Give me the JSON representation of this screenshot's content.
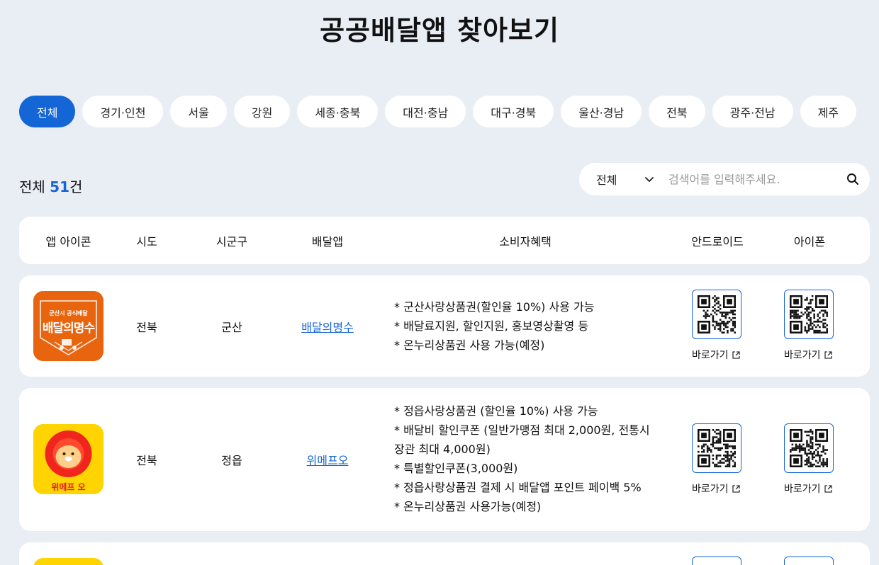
{
  "title": "공공배달앱 찾아보기",
  "regions": [
    "전체",
    "경기·인천",
    "서울",
    "강원",
    "세종·충북",
    "대전·충남",
    "대구·경북",
    "울산·경남",
    "전북",
    "광주·전남",
    "제주"
  ],
  "active_region": "전체",
  "result": {
    "prefix": "전체 ",
    "count": "51",
    "suffix": "건"
  },
  "search": {
    "select_value": "전체",
    "placeholder": "검색어를 입력해주세요."
  },
  "columns": [
    "앱 아이콘",
    "시도",
    "시군구",
    "배달앱",
    "소비자혜택",
    "안드로이드",
    "아이폰"
  ],
  "rows": [
    {
      "sido": "전북",
      "sigungu": "군산",
      "app": "배달의명수",
      "icon_top_text": "군산시 공식배달",
      "icon_main_text": "배달의명수",
      "benefits": [
        "* 군산사랑상품권(할인율 10%) 사용 가능",
        "* 배달료지원, 할인지원, 홍보영상촬영 등",
        "* 온누리상품권 사용 가능(예정)"
      ],
      "android_link": "바로가기",
      "ios_link": "바로가기"
    },
    {
      "sido": "전북",
      "sigungu": "정읍",
      "app": "위메프오",
      "icon_label": "위메프 오",
      "benefits": [
        "* 정읍사랑상품권 (할인율 10%) 사용 가능",
        "* 배달비 할인쿠폰 (일반가맹점 최대 2,000원, 전통시",
        "장관 최대 4,000원)",
        "* 특별할인쿠폰(3,000원)",
        "* 정읍사랑상품권 결제 시 배달앱 포인트 페이백 5%",
        "* 온누리상품권 사용가능(예정)"
      ],
      "android_link": "바로가기",
      "ios_link": "바로가기"
    }
  ],
  "colors": {
    "accent": "#1466d6",
    "background": "#e9eef5",
    "icon_orange": "#e8640e",
    "icon_yellow": "#ffd400"
  }
}
